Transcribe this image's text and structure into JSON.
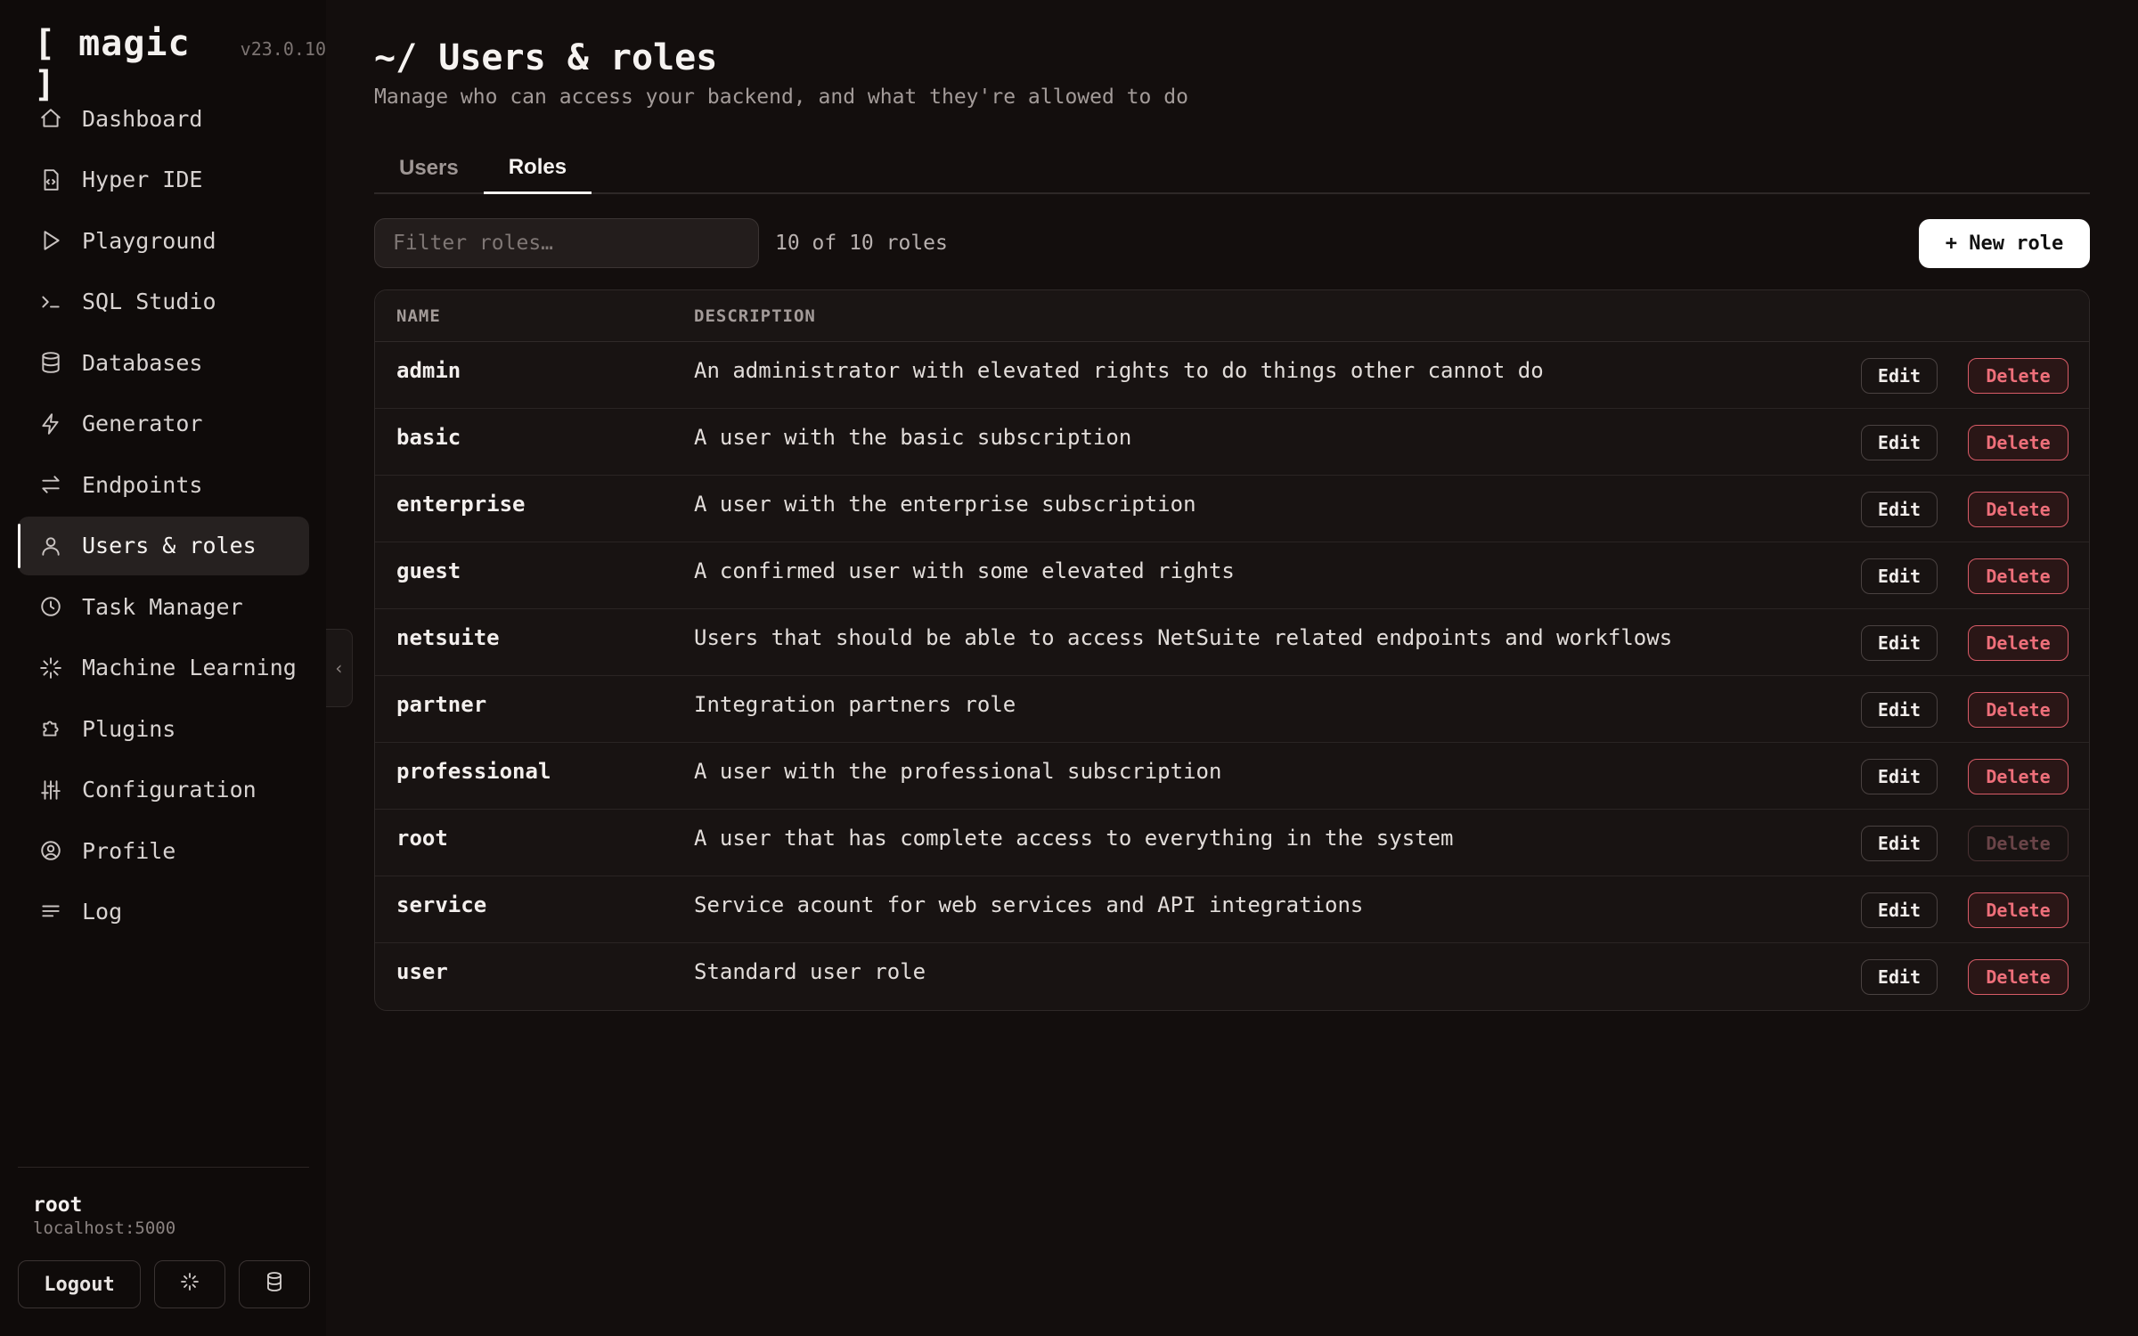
{
  "brand": {
    "name": "[ magic ]",
    "version": "v23.0.10"
  },
  "sidebar": {
    "items": [
      {
        "label": "Dashboard",
        "icon": "home-icon",
        "active": false
      },
      {
        "label": "Hyper IDE",
        "icon": "code-file-icon",
        "active": false
      },
      {
        "label": "Playground",
        "icon": "play-icon",
        "active": false
      },
      {
        "label": "SQL Studio",
        "icon": "terminal-icon",
        "active": false
      },
      {
        "label": "Databases",
        "icon": "database-icon",
        "active": false
      },
      {
        "label": "Generator",
        "icon": "lightning-icon",
        "active": false
      },
      {
        "label": "Endpoints",
        "icon": "arrows-icon",
        "active": false
      },
      {
        "label": "Users & roles",
        "icon": "user-icon",
        "active": true
      },
      {
        "label": "Task Manager",
        "icon": "clock-icon",
        "active": false
      },
      {
        "label": "Machine Learning",
        "icon": "sparkle-icon",
        "active": false
      },
      {
        "label": "Plugins",
        "icon": "puzzle-icon",
        "active": false
      },
      {
        "label": "Configuration",
        "icon": "sliders-icon",
        "active": false
      },
      {
        "label": "Profile",
        "icon": "user-circle-icon",
        "active": false
      },
      {
        "label": "Log",
        "icon": "list-icon",
        "active": false
      }
    ],
    "collapse_glyph": "‹",
    "user": {
      "name": "root",
      "host": "localhost:5000"
    },
    "logout_label": "Logout"
  },
  "header": {
    "title": "~/ Users & roles",
    "subtitle": "Manage who can access your backend, and what they're allowed to do"
  },
  "tabs": [
    {
      "label": "Users",
      "active": false
    },
    {
      "label": "Roles",
      "active": true
    }
  ],
  "toolbar": {
    "filter_placeholder": "Filter roles…",
    "filter_value": "",
    "count_text": "10 of 10 roles",
    "new_button_label": "+ New role"
  },
  "table": {
    "columns": [
      "NAME",
      "DESCRIPTION"
    ],
    "edit_label": "Edit",
    "delete_label": "Delete",
    "rows": [
      {
        "name": "admin",
        "description": "An administrator with elevated rights to do things other cannot do",
        "delete_enabled": true
      },
      {
        "name": "basic",
        "description": "A user with the basic subscription",
        "delete_enabled": true
      },
      {
        "name": "enterprise",
        "description": "A user with the enterprise subscription",
        "delete_enabled": true
      },
      {
        "name": "guest",
        "description": "A confirmed user with some elevated rights",
        "delete_enabled": true
      },
      {
        "name": "netsuite",
        "description": "Users that should be able to access NetSuite related endpoints and workflows",
        "delete_enabled": true
      },
      {
        "name": "partner",
        "description": "Integration partners role",
        "delete_enabled": true
      },
      {
        "name": "professional",
        "description": "A user with the professional subscription",
        "delete_enabled": true
      },
      {
        "name": "root",
        "description": "A user that has complete access to everything in the system",
        "delete_enabled": false
      },
      {
        "name": "service",
        "description": "Service acount for web services and API integrations",
        "delete_enabled": true
      },
      {
        "name": "user",
        "description": "Standard user role",
        "delete_enabled": true
      }
    ]
  },
  "colors": {
    "background": "#130e0d",
    "sidebar": "#0f0b0a",
    "danger": "#ee6f7a",
    "accent": "#ffffff"
  }
}
